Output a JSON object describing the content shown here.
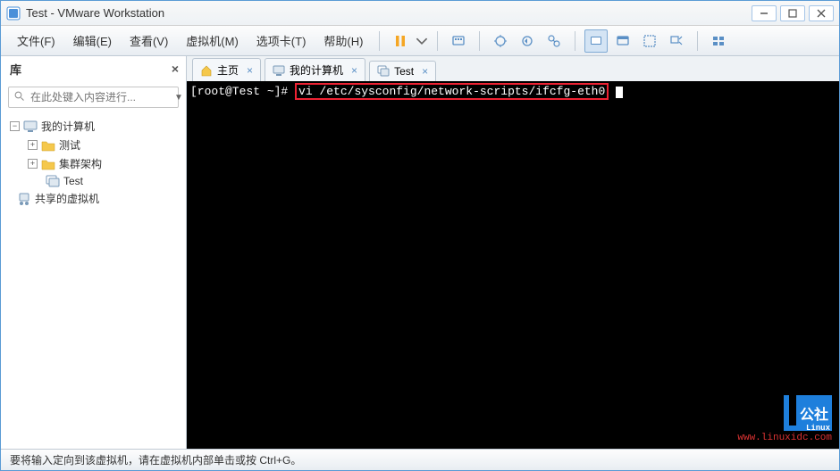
{
  "window": {
    "title": "Test - VMware Workstation"
  },
  "menu": {
    "file": "文件(F)",
    "edit": "编辑(E)",
    "view": "查看(V)",
    "vm": "虚拟机(M)",
    "tabs": "选项卡(T)",
    "help": "帮助(H)"
  },
  "sidebar": {
    "title": "库",
    "search_placeholder": "在此处键入内容进行...",
    "nodes": {
      "mycomputer": "我的计算机",
      "test_folder": "测试",
      "cluster": "集群架构",
      "test_vm": "Test",
      "shared": "共享的虚拟机"
    }
  },
  "tabs": [
    {
      "label": "主页",
      "icon": "home"
    },
    {
      "label": "我的计算机",
      "icon": "computer"
    },
    {
      "label": "Test",
      "icon": "vm"
    }
  ],
  "terminal": {
    "prompt": "[root@Test ~]# ",
    "command": "vi /etc/sysconfig/network-scripts/ifcfg-eth0"
  },
  "watermark": {
    "logo": "公社",
    "sub": "Linux",
    "url": "www.linuxidc.com"
  },
  "statusbar": {
    "text": "要将输入定向到该虚拟机，请在虚拟机内部单击或按 Ctrl+G。"
  }
}
